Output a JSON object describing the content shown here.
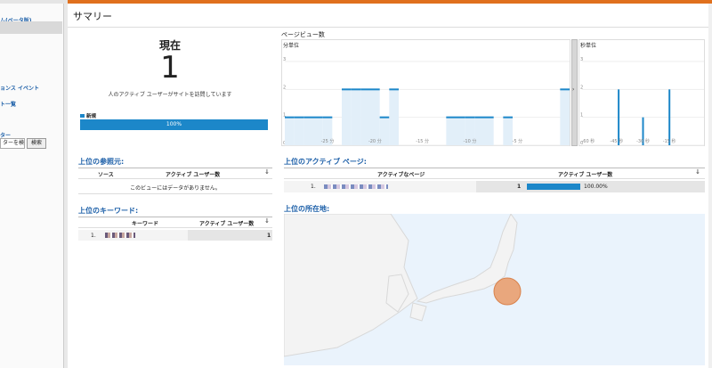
{
  "sidebar": {
    "link1": "ム(ベータ版)",
    "link2": "ョンス イベント",
    "link3": "ト一覧",
    "search_label": "ター",
    "search_value": "ターを検索",
    "search_button": "検索"
  },
  "header": {
    "title": "サマリー"
  },
  "realtime": {
    "now_label": "現在",
    "active_count": "1",
    "description": "人のアクティブ ユーザーがサイトを訪問しています",
    "legend_new": "新規",
    "bar_percent": "100%",
    "bar_fraction": 1.0
  },
  "pageviews": {
    "title": "ページビュー数",
    "per_minute_label": "分単位",
    "per_second_label": "秒単位"
  },
  "referrers": {
    "title": "上位の参照元:",
    "col_source": "ソース",
    "col_users": "アクティブ ユーザー数",
    "empty_text": "このビューにはデータがありません。"
  },
  "keywords": {
    "title": "上位のキーワード:",
    "col_keyword": "キーワード",
    "col_users": "アクティブ ユーザー数",
    "rows": [
      {
        "rank": "1.",
        "users": "1"
      }
    ]
  },
  "active_pages": {
    "title": "上位のアクティブ ページ:",
    "col_page": "アクティブなページ",
    "col_users": "アクティブ ユーザー数",
    "rows": [
      {
        "rank": "1.",
        "users": "1",
        "percent": "100.00%",
        "fraction": 1.0
      }
    ]
  },
  "locations": {
    "title": "上位の所在地:"
  },
  "colors": {
    "accent": "#e0701d",
    "bar": "#1c87c9",
    "link": "#1c5fa8"
  },
  "chart_data": [
    {
      "type": "bar",
      "title": "ページビュー数",
      "subtitle": "分単位",
      "ylim": [
        0,
        3
      ],
      "y_ticks": [
        "0",
        "1",
        "2",
        "3"
      ],
      "x_tick_labels": [
        "-25 分",
        "-20 分",
        "-15 分",
        "-10 分",
        "-5 分"
      ],
      "x_offsets_minutes": [
        -29,
        -28,
        -27,
        -26,
        -25,
        -24,
        -23,
        -22,
        -21,
        -20,
        -19,
        -18,
        -17,
        -16,
        -15,
        -14,
        -13,
        -12,
        -11,
        -10,
        -9,
        -8,
        -7,
        -6,
        -5,
        -4,
        -3,
        -2,
        -1,
        0
      ],
      "values": [
        1,
        1,
        1,
        1,
        1,
        0,
        2,
        2,
        2,
        2,
        1,
        2,
        0,
        0,
        0,
        0,
        0,
        1,
        1,
        1,
        1,
        1,
        0,
        1,
        0,
        0,
        0,
        0,
        0,
        2
      ]
    },
    {
      "type": "bar",
      "title": "ページビュー数",
      "subtitle": "秒単位",
      "ylim": [
        0,
        3
      ],
      "y_ticks": [
        "0",
        "1",
        "2",
        "3"
      ],
      "x_tick_labels": [
        "-60 秒",
        "-45 秒",
        "-30 秒",
        "-15 秒"
      ],
      "spikes": [
        {
          "seconds": -42,
          "value": 2
        },
        {
          "seconds": -30,
          "value": 1
        },
        {
          "seconds": -17,
          "value": 2
        }
      ]
    }
  ]
}
